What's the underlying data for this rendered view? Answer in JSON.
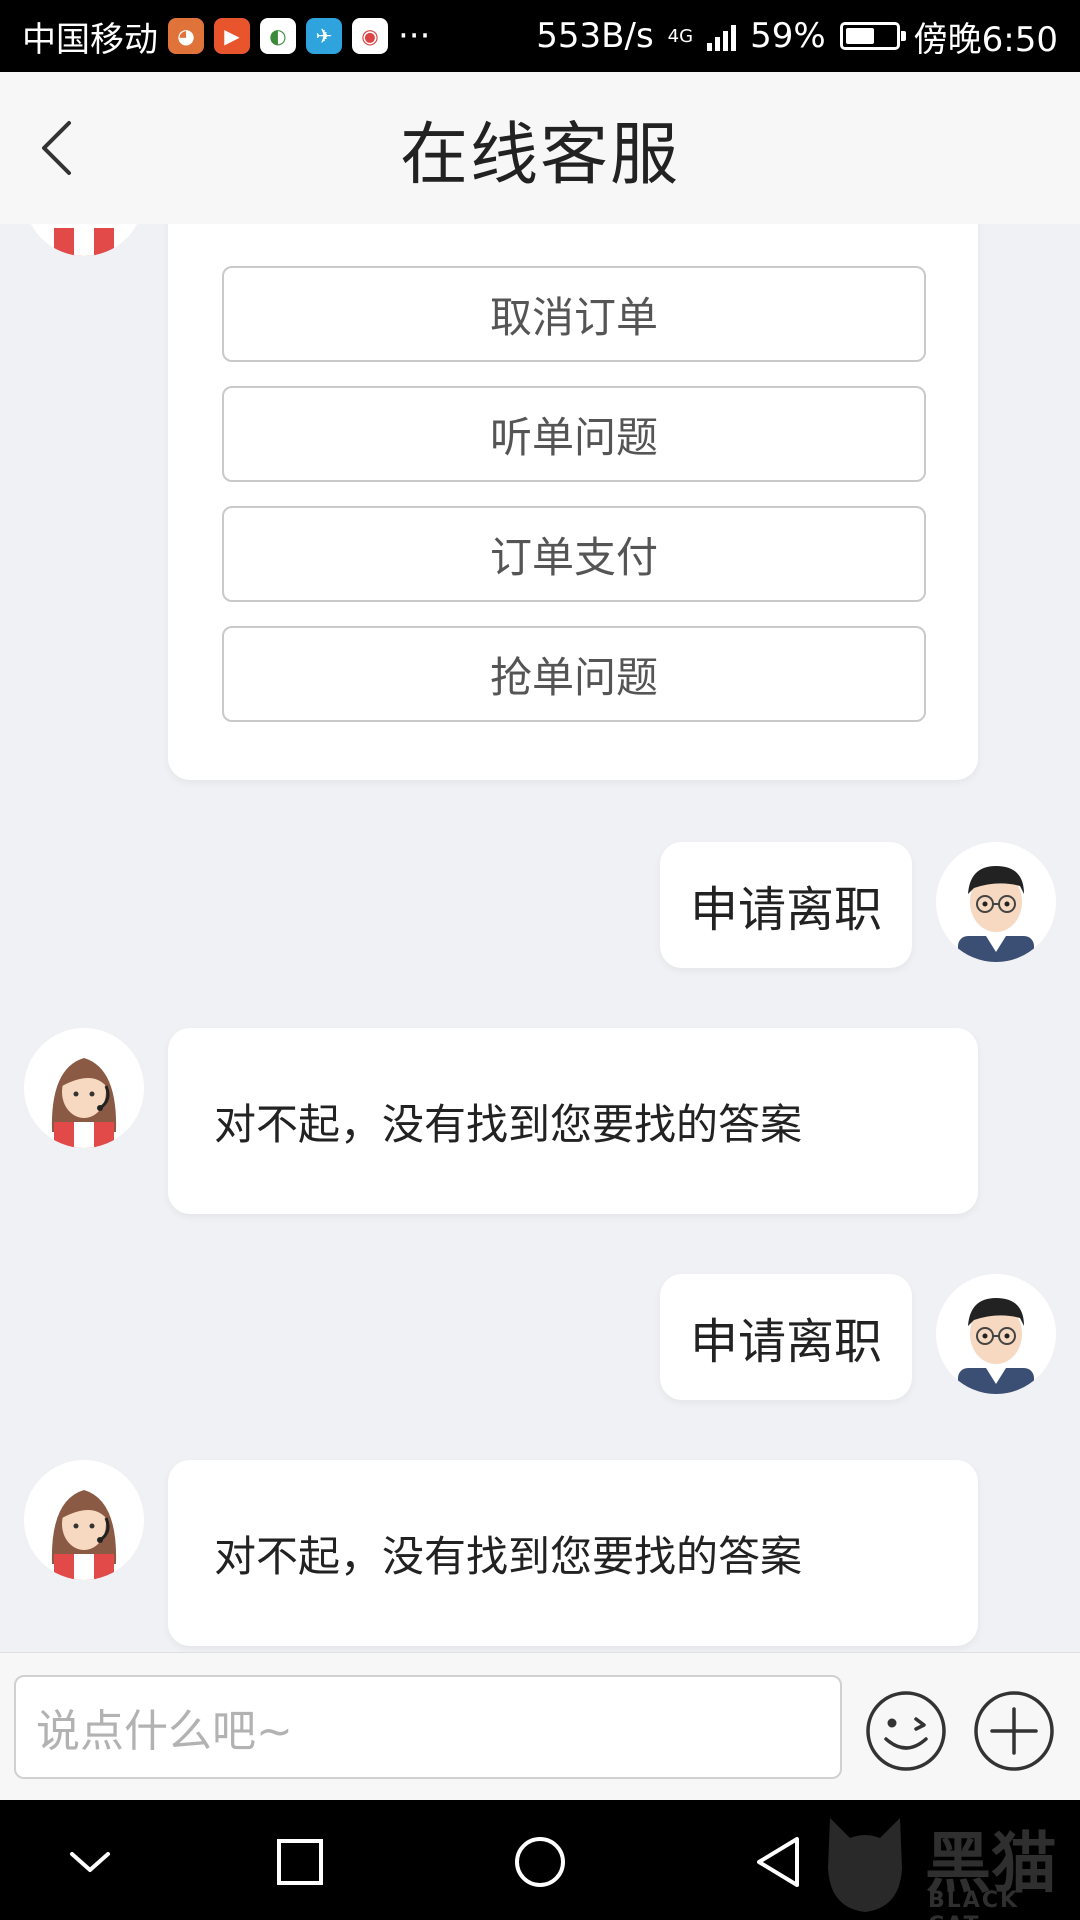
{
  "status_bar": {
    "carrier": "中国移动",
    "more": "···",
    "net_speed": "553B/s",
    "network": "4G",
    "battery": "59%",
    "time": "傍晚6:50"
  },
  "header": {
    "title": "在线客服",
    "back_icon": "chevron-left-icon"
  },
  "chat": {
    "options": [
      "取消订单",
      "听单问题",
      "订单支付",
      "抢单问题"
    ],
    "messages": [
      {
        "from": "user",
        "text": "申请离职"
      },
      {
        "from": "bot",
        "text": "对不起，没有找到您要找的答案"
      },
      {
        "from": "user",
        "text": "申请离职"
      },
      {
        "from": "bot",
        "text": "对不起，没有找到您要找的答案"
      }
    ]
  },
  "input": {
    "placeholder": "说点什么吧~",
    "emoji_icon": "emoji-icon",
    "plus_icon": "plus-icon"
  },
  "nav": {
    "icons": [
      "chevron-down-icon",
      "square-icon",
      "circle-icon",
      "triangle-back-icon"
    ]
  },
  "watermark": {
    "text": "黑猫",
    "sub": "BLACK CAT"
  }
}
